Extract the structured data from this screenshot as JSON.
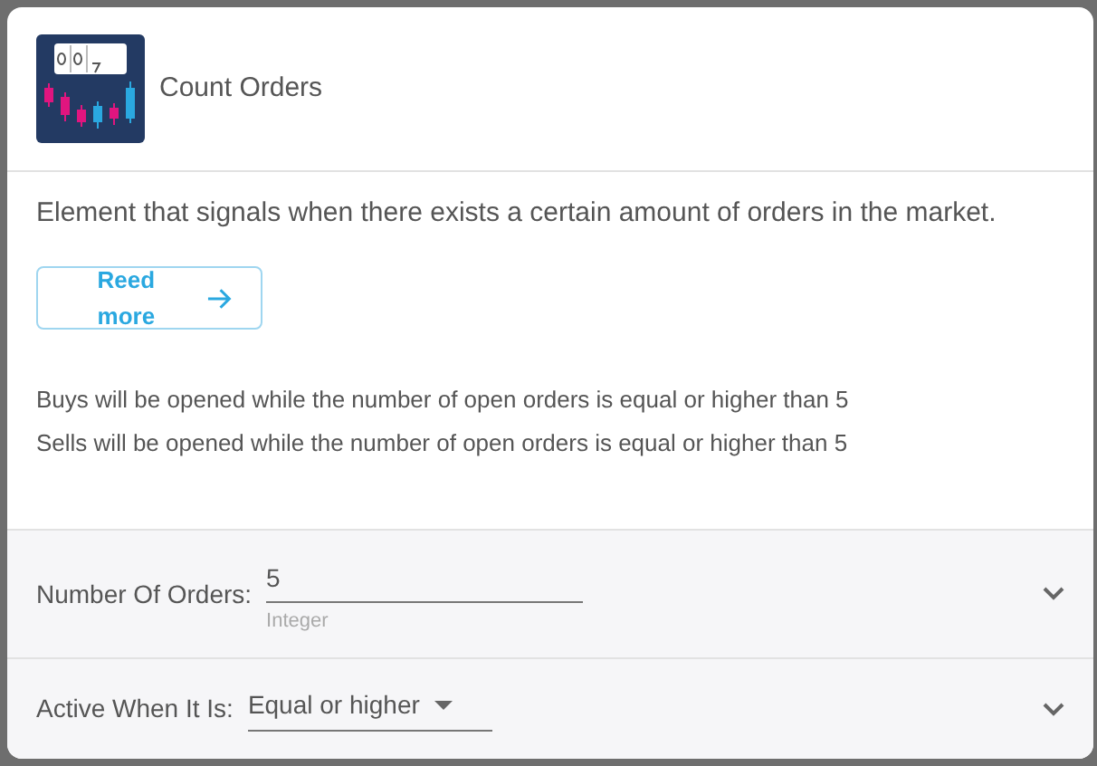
{
  "header": {
    "title": "Count Orders"
  },
  "description": "Element that signals when there exists a certain amount of orders in the market.",
  "read_more_button": {
    "label": "Reed more"
  },
  "notes": [
    "Buys will be opened while the number of open orders is equal or higher than 5",
    "Sells will be opened while the number of open orders is equal or higher than 5"
  ],
  "parameters": [
    {
      "kind": "input",
      "label": "Number Of Orders:",
      "value": "5",
      "hint": "Integer",
      "expanded": false
    },
    {
      "kind": "dropdown",
      "label": "Active When It Is:",
      "value": "Equal or higher",
      "expanded": false
    }
  ]
}
